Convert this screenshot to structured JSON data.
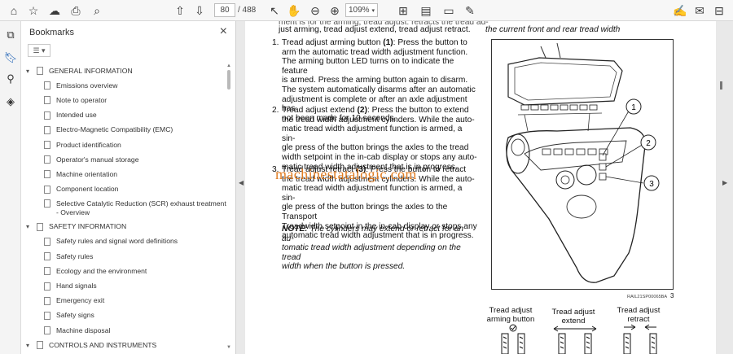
{
  "toolbar": {
    "page_current": "80",
    "page_total": "/ 488",
    "zoom": "109%"
  },
  "bookmarks": {
    "title": "Bookmarks",
    "items": [
      {
        "label": "GENERAL INFORMATION",
        "level": "top"
      },
      {
        "label": "Emissions overview",
        "level": "sub"
      },
      {
        "label": "Note to operator",
        "level": "sub"
      },
      {
        "label": "Intended use",
        "level": "sub"
      },
      {
        "label": "Electro-Magnetic Compatibility (EMC)",
        "level": "sub"
      },
      {
        "label": "Product identification",
        "level": "sub"
      },
      {
        "label": "Operator's manual storage",
        "level": "sub"
      },
      {
        "label": "Machine orientation",
        "level": "sub"
      },
      {
        "label": "Component location",
        "level": "sub"
      },
      {
        "label": "Selective Catalytic Reduction (SCR) exhaust treatment - Overview",
        "level": "sub",
        "tall": true
      },
      {
        "label": "SAFETY INFORMATION",
        "level": "top"
      },
      {
        "label": "Safety rules and signal word definitions",
        "level": "sub"
      },
      {
        "label": "Safety rules",
        "level": "sub"
      },
      {
        "label": "Ecology and the environment",
        "level": "sub"
      },
      {
        "label": "Hand signals",
        "level": "sub"
      },
      {
        "label": "Emergency exit",
        "level": "sub"
      },
      {
        "label": "Safety signs",
        "level": "sub"
      },
      {
        "label": "Machine disposal",
        "level": "sub"
      },
      {
        "label": "CONTROLS AND INSTRUMENTS",
        "level": "top"
      }
    ]
  },
  "document": {
    "cut_line_left": "just arming, tread adjust extend, tread adjust retract.",
    "cut_line_right": "the current front and rear tread width",
    "item1_num": "1.",
    "item1_title": "Tread adjust arming button",
    "item1_ref": "(1)",
    "item1_lines": [
      ": Press the button to",
      "arm the automatic tread width adjustment function.",
      "The arming button LED turns on to indicate the feature",
      "is armed. Press the arming button again to disarm.",
      "The system automatically disarms after an automatic",
      "adjustment is complete or after an axle adjustment has",
      "not been made for 10 seconds."
    ],
    "item2_num": "2.",
    "item2_title": "Tread adjust extend",
    "item2_ref": "(2)",
    "item2_lines": [
      ": Press the button to extend",
      "the tread width adjustment cylinders. While the auto-",
      "matic tread width adjustment function is armed, a sin-",
      "gle press of the button brings the axles to the tread",
      "width setpoint in the in-cab display or stops any auto-",
      "matic tread width adjustment that is in progress."
    ],
    "item3_num": "3.",
    "item3_title": "Tread adjust retract",
    "item3_ref": "(3)",
    "item3_lines": [
      ": Press the button to retract",
      "the tread width adjustment cylinders. While the auto-",
      "matic tread width adjustment function is armed, a sin-",
      "gle press of the button brings the axles to the Transport",
      "Treadwidth setpoint in the in-cab display or stops any",
      "automatic tread width adjustment that is in progress."
    ],
    "note_label": "NOTE:",
    "note_lines": [
      " The cylinders may extend or retract for an au-",
      "tomatic tread width adjustment depending on the tread",
      "width when the button is pressed."
    ],
    "watermark": "machinestatalogic.com",
    "figure": {
      "callouts": [
        "1",
        "2",
        "3"
      ],
      "code": "RAIL21SP00065BA",
      "fig_number": "3"
    },
    "legend": [
      {
        "line1": "Tread adjust",
        "line2": "arming button"
      },
      {
        "line1": "Tread adjust",
        "line2": "extend"
      },
      {
        "line1": "Tread adjust",
        "line2": "retract"
      }
    ]
  }
}
